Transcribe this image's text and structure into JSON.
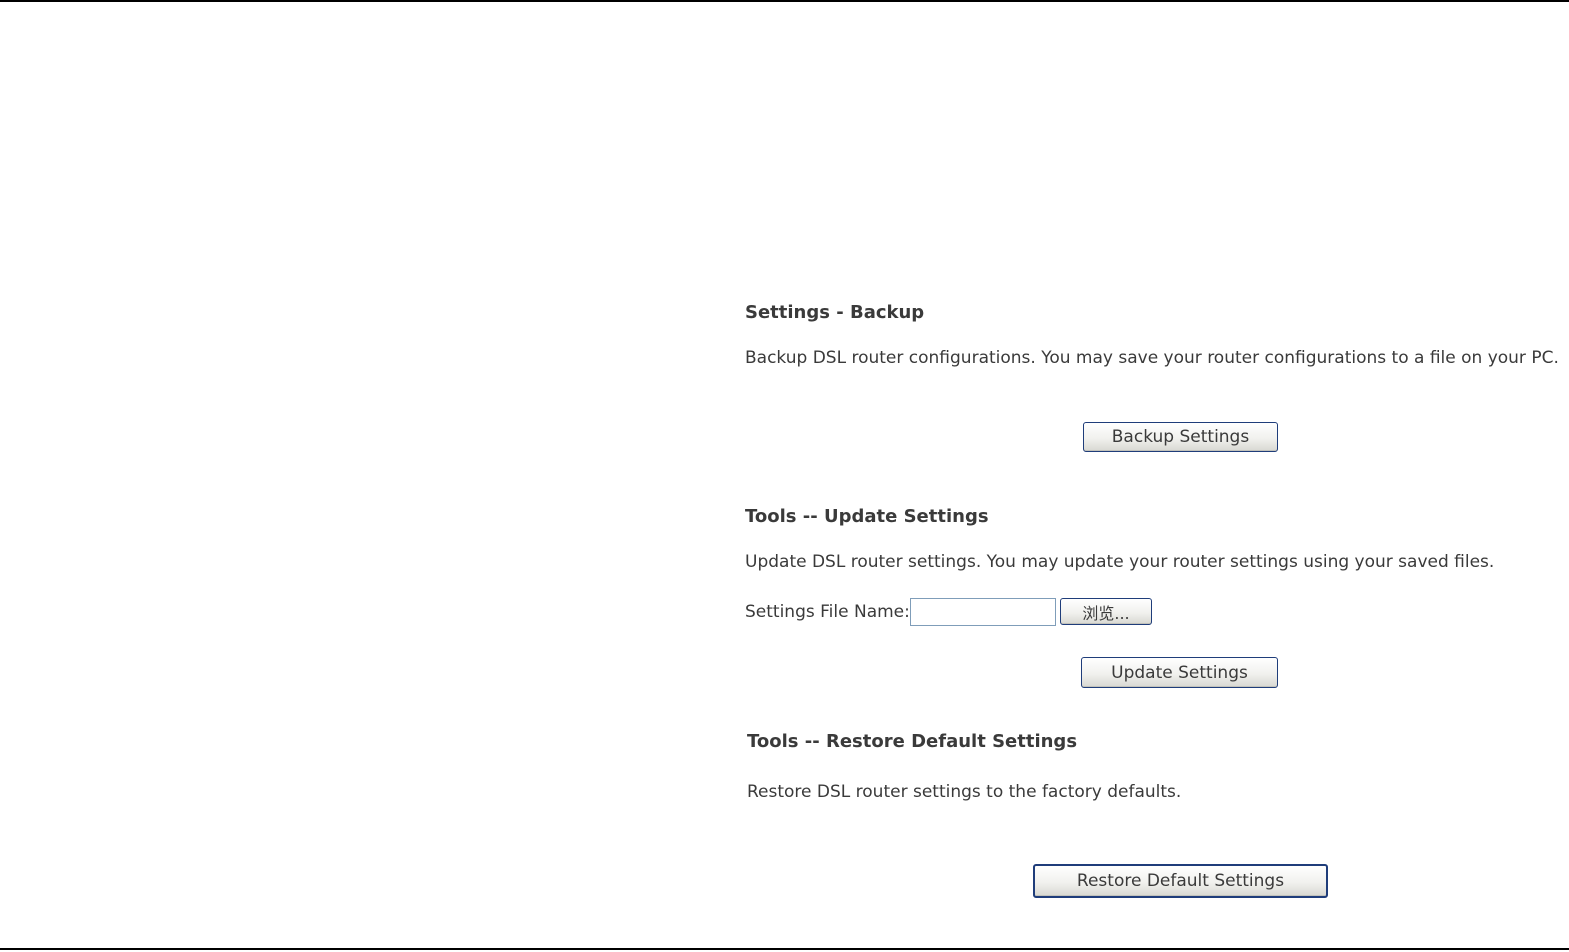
{
  "backup": {
    "title": "Settings - Backup",
    "description": "Backup DSL router configurations. You may save your router configurations to a file on your PC.",
    "button_label": "Backup Settings"
  },
  "update": {
    "title": "Tools -- Update Settings",
    "description": "Update DSL router settings. You may update your router settings using your saved files.",
    "file_label": "Settings File Name:",
    "file_value": "",
    "browse_label": "浏览...",
    "button_label": "Update Settings"
  },
  "restore": {
    "title": "Tools -- Restore Default Settings",
    "description": "Restore DSL router settings to the factory defaults.",
    "button_label": "Restore Default Settings"
  },
  "colors": {
    "button_border": "#1f3d7a",
    "text": "#3a3a3a",
    "rule": "#000000"
  }
}
